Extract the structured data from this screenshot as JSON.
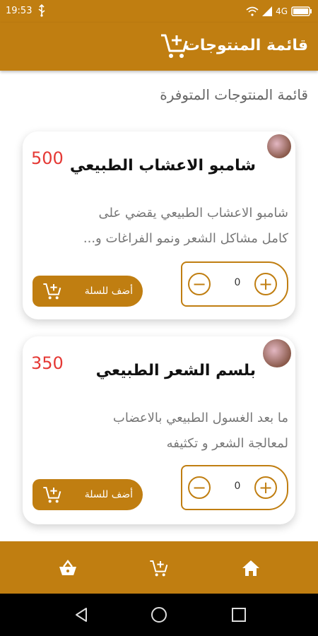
{
  "status_bar": {
    "time": "19:53",
    "network": "4G",
    "icons": [
      "usb-icon",
      "wifi-icon",
      "signal-icon",
      "battery-icon"
    ]
  },
  "app_bar": {
    "title": "قائمة المنتوجات",
    "icon": "add-to-cart-icon"
  },
  "section_title": "قائمة المنتوجات المتوفرة",
  "products": [
    {
      "name": "شامبو الاعشاب الطبيعي",
      "price": "500",
      "desc_line1": "شامبو الاعشاب الطبيعي يقضي على",
      "desc_line2": "كامل مشاكل الشعر ونمو الفراغات و...",
      "quantity": "0",
      "add_label": "أضف للسلة"
    },
    {
      "name": "بلسم الشعر الطبيعي",
      "price": "350",
      "desc_line1": "ما بعد الغسول الطبيعي بالاعضاب",
      "desc_line2": "لمعالجة الشعر و تكثيفه",
      "quantity": "0",
      "add_label": "أضف للسلة"
    }
  ],
  "bottom_nav": [
    "basket-icon",
    "add-to-cart-icon",
    "home-icon"
  ],
  "system_nav": [
    "back-icon",
    "home-circle-icon",
    "recents-icon"
  ],
  "colors": {
    "primary": "#c07e11",
    "price": "#e53935"
  }
}
